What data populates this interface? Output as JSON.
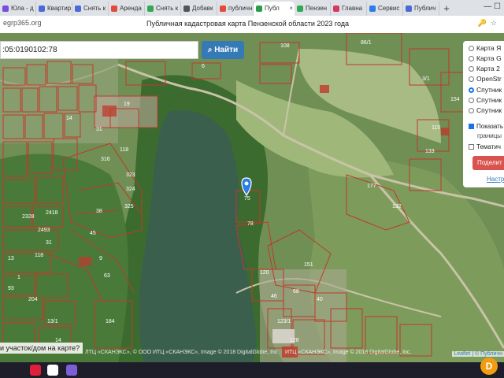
{
  "browser": {
    "tabs": [
      {
        "label": "Юла - д",
        "color": "#7b4ce0"
      },
      {
        "label": "Квартир",
        "color": "#4b6ad8"
      },
      {
        "label": "Снять к",
        "color": "#4b6ad8"
      },
      {
        "label": "Аренда",
        "color": "#e24a3b"
      },
      {
        "label": "Снять к",
        "color": "#33a852"
      },
      {
        "label": "Добавк",
        "color": "#555555"
      },
      {
        "label": "публичн",
        "color": "#e24a3b"
      },
      {
        "label": "Публ",
        "color": "#2a9d48",
        "active": true
      },
      {
        "label": "Пензен",
        "color": "#33a852"
      },
      {
        "label": "Главна",
        "color": "#d23a64"
      },
      {
        "label": "Сервис",
        "color": "#2b7de9"
      },
      {
        "label": "Публич",
        "color": "#4b6ad8"
      }
    ],
    "new_tab": "+",
    "close_glyph": "×",
    "address": "egrp365.org",
    "page_title": "Публичная кадастровая карта Пензенской области 2023 года"
  },
  "map": {
    "search_value": ":05:0190102:78",
    "search_button": "Найти",
    "layers": [
      {
        "label": "Карта Я",
        "selected": false
      },
      {
        "label": "Карта G",
        "selected": false
      },
      {
        "label": "Карта 2",
        "selected": false
      },
      {
        "label": "OpenStr",
        "selected": false
      },
      {
        "label": "Спутник",
        "selected": true
      },
      {
        "label": "Спутник",
        "selected": false
      },
      {
        "label": "Спутник",
        "selected": false
      }
    ],
    "show_borders": {
      "label": "Показать",
      "sub": "границы",
      "checked": true
    },
    "thematic": {
      "label": "Тематич",
      "checked": false
    },
    "share_button": "Поделит",
    "settings_link": "Настро",
    "prompt": "и участок/дом на карте?",
    "attribution_left": "ЛТЦ «СКАНЭКС», © ООО ИТЦ «СКАНЭКС», Image © 2018 DigitalGlobe, Inc",
    "attribution_right": "ИТЦ «СКАНЭКС», Image © 2018 DigitalGlobe, Inc.",
    "leaflet_label": "Leaflet | © Публичн",
    "plot_numbers": [
      "108",
      "86/1",
      "6",
      "3/1",
      "19",
      "31",
      "316",
      "118",
      "323",
      "324",
      "325",
      "38",
      "45",
      "2418",
      "2328",
      "2493",
      "31",
      "13",
      "118",
      "1",
      "9",
      "63",
      "93",
      "204",
      "13/1",
      "184",
      "14",
      "75",
      "78",
      "151",
      "120",
      "46",
      "40",
      "68",
      "123/1",
      "128",
      "177",
      "132",
      "133",
      "115",
      "154",
      "14"
    ],
    "colors": {
      "parcel": "#c0392b",
      "water": "#3b5f4d",
      "forest": "#3c6b2f",
      "field": "#8fa86b",
      "road": "#c9c3a8",
      "accent": "#337ab7"
    }
  },
  "taskbar": {
    "apps": [
      {
        "name": "opera-icon",
        "color": "#e0203a"
      },
      {
        "name": "yandex-icon",
        "color": "#ffffff"
      },
      {
        "name": "viber-icon",
        "color": "#7b5fd6"
      }
    ]
  }
}
